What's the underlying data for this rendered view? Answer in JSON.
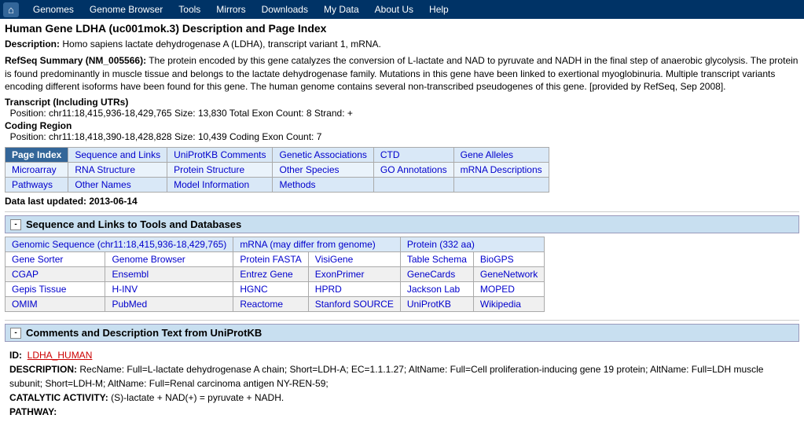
{
  "navbar": {
    "home_icon": "🏠",
    "items": [
      "Genomes",
      "Genome Browser",
      "Tools",
      "Mirrors",
      "Downloads",
      "My Data",
      "About Us",
      "Help"
    ]
  },
  "page": {
    "title": "Human Gene LDHA (uc001mok.3) Description and Page Index",
    "description_label": "Description:",
    "description": "Homo sapiens lactate dehydrogenase A (LDHA), transcript variant 1, mRNA.",
    "refseq_label": "RefSeq Summary (NM_005566):",
    "refseq": "The protein encoded by this gene catalyzes the conversion of L-lactate and NAD to pyruvate and NADH in the final step of anaerobic glycolysis. The protein is found predominantly in muscle tissue and belongs to the lactate dehydrogenase family. Mutations in this gene have been linked to exertional myoglobinuria. Multiple transcript variants encoding different isoforms have been found for this gene. The human genome contains several non-transcribed pseudogenes of this gene. [provided by RefSeq, Sep 2008].",
    "transcript_label": "Transcript (Including UTRs)",
    "transcript_position": "Position: chr11:18,415,936-18,429,765  Size: 13,830  Total Exon Count: 8  Strand: +",
    "coding_label": "Coding Region",
    "coding_position": "Position: chr11:18,418,390-18,428,828  Size: 10,439  Coding Exon Count: 7"
  },
  "page_index": {
    "header": "Page Index",
    "cells": [
      [
        "Sequence and Links",
        "UniProtKB Comments",
        "Genetic Associations",
        "CTD",
        "Gene Alleles"
      ],
      [
        "Microarray",
        "RNA Structure",
        "Protein Structure",
        "Other Species",
        "GO Annotations",
        "mRNA Descriptions"
      ],
      [
        "Pathways",
        "Other Names",
        "Model Information",
        "Methods",
        "",
        ""
      ]
    ]
  },
  "data_updated": "Data last updated: 2013-06-14",
  "links_section": {
    "title": "Sequence and Links to Tools and Databases",
    "genomic_seq": "Genomic Sequence (chr11:18,415,936-18,429,765)",
    "mrna": "mRNA (may differ from genome)",
    "protein": "Protein (332 aa)",
    "rows": [
      [
        "Gene Sorter",
        "Genome Browser",
        "Protein FASTA",
        "VisiGene",
        "Table Schema",
        "BioGPS"
      ],
      [
        "CGAP",
        "Ensembl",
        "Entrez Gene",
        "ExonPrimer",
        "GeneCards",
        "GeneNetwork"
      ],
      [
        "Gepis Tissue",
        "H-INV",
        "HGNC",
        "HPRD",
        "Jackson Lab",
        "MOPED"
      ],
      [
        "OMIM",
        "PubMed",
        "Reactome",
        "Stanford SOURCE",
        "UniProtKB",
        "Wikipedia"
      ]
    ]
  },
  "uniprot_section": {
    "title": "Comments and Description Text from UniProtKB",
    "id_label": "ID:",
    "id_value": "LDHA_HUMAN",
    "description_label": "DESCRIPTION:",
    "description": "RecName: Full=L-lactate dehydrogenase A chain; Short=LDH-A; EC=1.1.1.27; AltName: Full=Cell proliferation-inducing gene 19 protein; AltName: Full=LDH muscle subunit; Short=LDH-M; AltName: Full=Renal carcinoma antigen NY-REN-59;",
    "catalytic_label": "CATALYTIC ACTIVITY:",
    "catalytic": "(S)-lactate + NAD(+) = pyruvate + NADH.",
    "pathway_label": "PATHWAY:"
  }
}
